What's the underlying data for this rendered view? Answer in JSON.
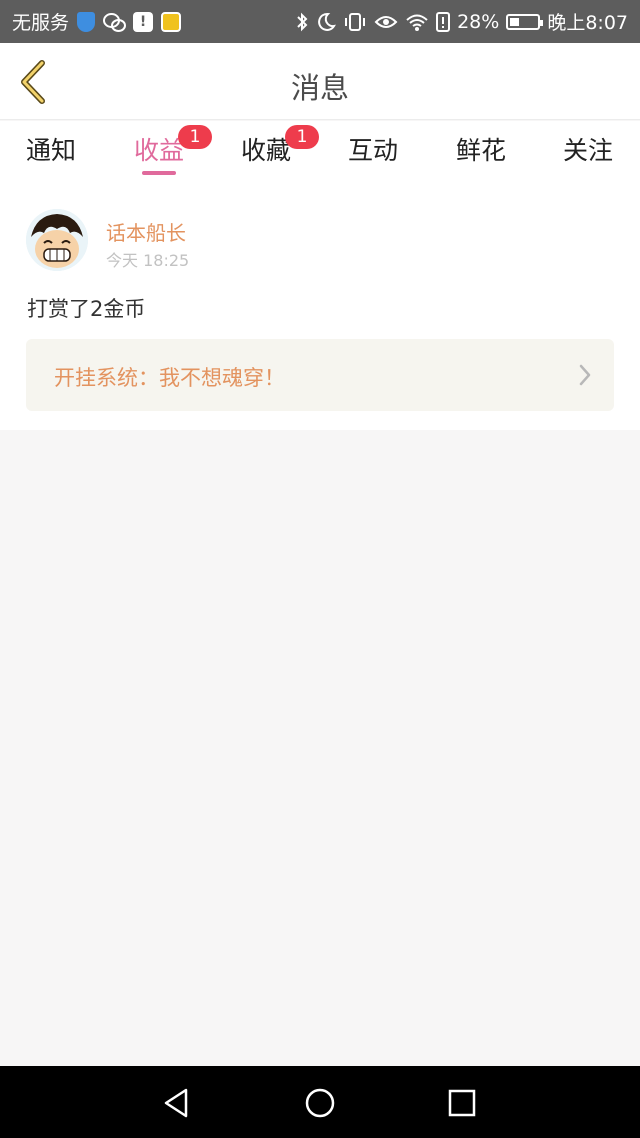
{
  "status_bar": {
    "carrier": "无服务",
    "battery": "28%",
    "time": "晚上8:07",
    "msg_icon": "!"
  },
  "header": {
    "title": "消息"
  },
  "tabs": [
    {
      "label": "通知",
      "badge": null
    },
    {
      "label": "收益",
      "badge": "1",
      "active": true
    },
    {
      "label": "收藏",
      "badge": "1"
    },
    {
      "label": "互动",
      "badge": null
    },
    {
      "label": "鲜花",
      "badge": null
    },
    {
      "label": "关注",
      "badge": null
    }
  ],
  "message": {
    "sender": "话本船长",
    "time": "今天 18:25",
    "content": "打赏了2金币",
    "book_title": "开挂系统：我不想魂穿！"
  },
  "colors": {
    "accent": "#e06a9c",
    "badge": "#ee3c4c",
    "sender_text": "#e3935f",
    "link_bg": "#f6f5ef"
  },
  "icons": [
    "back-icon",
    "chevron-right-icon",
    "nav-back-icon",
    "nav-home-icon",
    "nav-recents-icon",
    "bluetooth-icon",
    "moon-icon",
    "vibrate-icon",
    "eye-icon",
    "wifi-icon",
    "battery-icon"
  ]
}
